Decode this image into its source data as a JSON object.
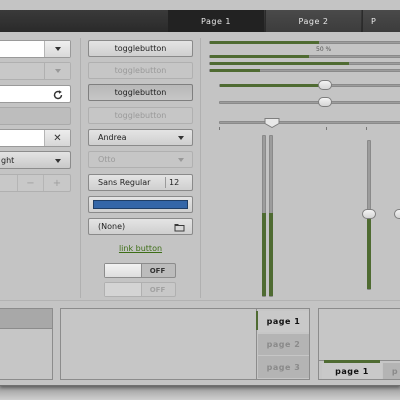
{
  "header": {
    "tabs": [
      {
        "label": "Page 1",
        "active": true
      },
      {
        "label": "Page 2",
        "active": false
      },
      {
        "label": "P",
        "active": false
      }
    ]
  },
  "left_column": {
    "search_entry_value": "",
    "combo_entry_1_value": "",
    "refresh_entry_value": "",
    "clear_entry_value": "",
    "combo_box_value": "ght",
    "spin_minus": "−",
    "spin_plus": "+"
  },
  "buttons": {
    "toggle_1": "togglebutton",
    "toggle_2": "togglebutton",
    "toggle_3": "togglebutton",
    "toggle_4": "togglebutton",
    "combo_andrea": "Andrea",
    "combo_otto": "Otto",
    "font_name": "Sans Regular",
    "font_size": "12",
    "file_chooser": "(None)",
    "link": "link button",
    "switch_on_label": "OFF",
    "switch_off_label": "OFF"
  },
  "progress": {
    "bar1_fraction": 0.55,
    "bar2_label": "50 %",
    "bar2_fraction": 0.5,
    "bar3_fraction": 0.7,
    "bar4_fraction": 0.25,
    "scale1_value": 0.55,
    "scale2_value": 0.55,
    "scale3_value": 0.3
  },
  "bottom": {
    "notebook_right_tabs": [
      "page 1",
      "page 2",
      "page 3"
    ],
    "notebook_bottom_tabs": [
      "page 1",
      "p"
    ]
  },
  "colors": {
    "accent_green": "#4f6b32",
    "color_button": "#3466a8"
  }
}
